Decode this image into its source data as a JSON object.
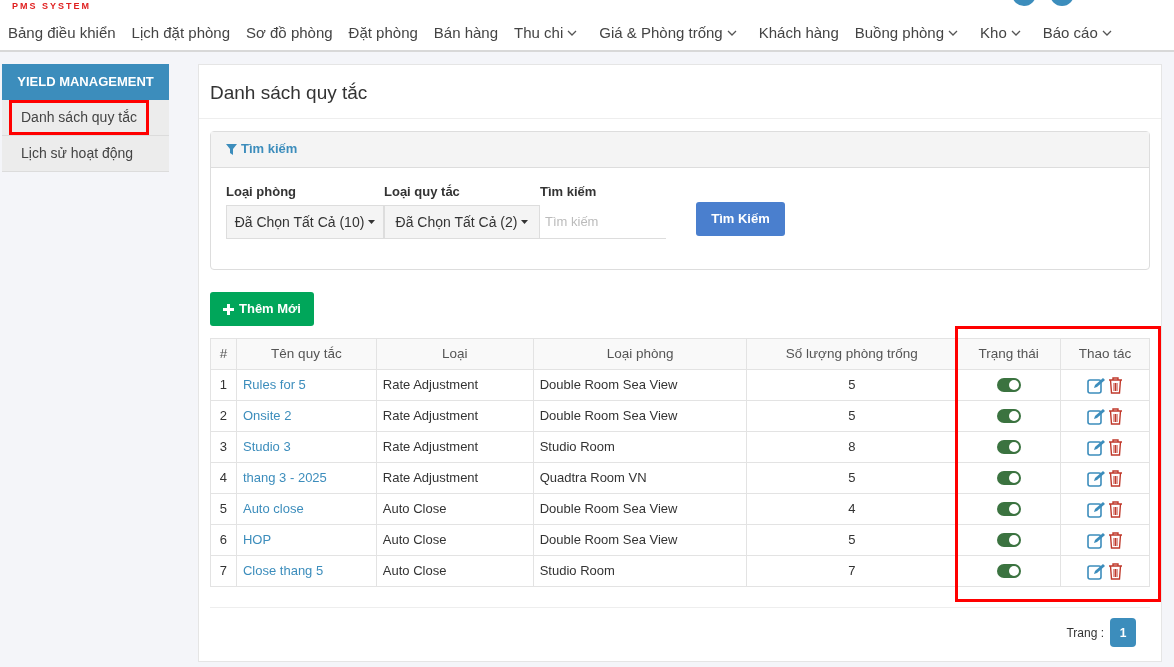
{
  "logo": "PMS SYSTEM",
  "nav": [
    {
      "label": "Bảng điều khiển",
      "dropdown": false
    },
    {
      "label": "Lịch đặt phòng",
      "dropdown": false
    },
    {
      "label": "Sơ đồ phòng",
      "dropdown": false
    },
    {
      "label": "Đặt phòng",
      "dropdown": false
    },
    {
      "label": "Bán hàng",
      "dropdown": false
    },
    {
      "label": "Thu chi",
      "dropdown": true
    },
    {
      "label": "Giá & Phòng trống",
      "dropdown": true
    },
    {
      "label": "Khách hàng",
      "dropdown": false
    },
    {
      "label": "Buồng phòng",
      "dropdown": true
    },
    {
      "label": "Kho",
      "dropdown": true
    },
    {
      "label": "Báo cáo",
      "dropdown": true
    }
  ],
  "sidebar": {
    "title": "YIELD MANAGEMENT",
    "items": [
      {
        "label": "Danh sách quy tắc",
        "selected": true
      },
      {
        "label": "Lịch sử hoạt động",
        "selected": false
      }
    ]
  },
  "page_title": "Danh sách quy tắc",
  "search": {
    "title": "Tìm kiếm",
    "room_type": {
      "label": "Loại phòng",
      "value": "Đã Chọn Tất Cả (10)"
    },
    "rule_type": {
      "label": "Loại quy tắc",
      "value": "Đã Chọn Tất Cả (2)"
    },
    "keyword": {
      "label": "Tìm kiếm",
      "placeholder": "Tìm kiếm"
    },
    "button": "Tìm Kiếm"
  },
  "add_button": "Thêm Mới",
  "table": {
    "columns": [
      "#",
      "Tên quy tắc",
      "Loại",
      "Loại phòng",
      "Số lượng phòng trống",
      "Trạng thái",
      "Thao tác"
    ],
    "rows": [
      {
        "index": "1",
        "name": "Rules for 5",
        "type": "Rate Adjustment",
        "room": "Double Room Sea View",
        "available": "5",
        "on": true
      },
      {
        "index": "2",
        "name": "Onsite 2",
        "type": "Rate Adjustment",
        "room": "Double Room Sea View",
        "available": "5",
        "on": true
      },
      {
        "index": "3",
        "name": "Studio 3",
        "type": "Rate Adjustment",
        "room": "Studio Room",
        "available": "8",
        "on": true
      },
      {
        "index": "4",
        "name": "thang 3 - 2025",
        "type": "Rate Adjustment",
        "room": "Quadtra Room VN",
        "available": "5",
        "on": true
      },
      {
        "index": "5",
        "name": "Auto close",
        "type": "Auto Close",
        "room": "Double Room Sea View",
        "available": "4",
        "on": true
      },
      {
        "index": "6",
        "name": "HOP",
        "type": "Auto Close",
        "room": "Double Room Sea View",
        "available": "5",
        "on": true
      },
      {
        "index": "7",
        "name": "Close thang 5",
        "type": "Auto Close",
        "room": "Studio Room",
        "available": "7",
        "on": true
      }
    ]
  },
  "pagination": {
    "label": "Trang :",
    "pages": [
      {
        "label": "1",
        "selected": true
      }
    ]
  }
}
